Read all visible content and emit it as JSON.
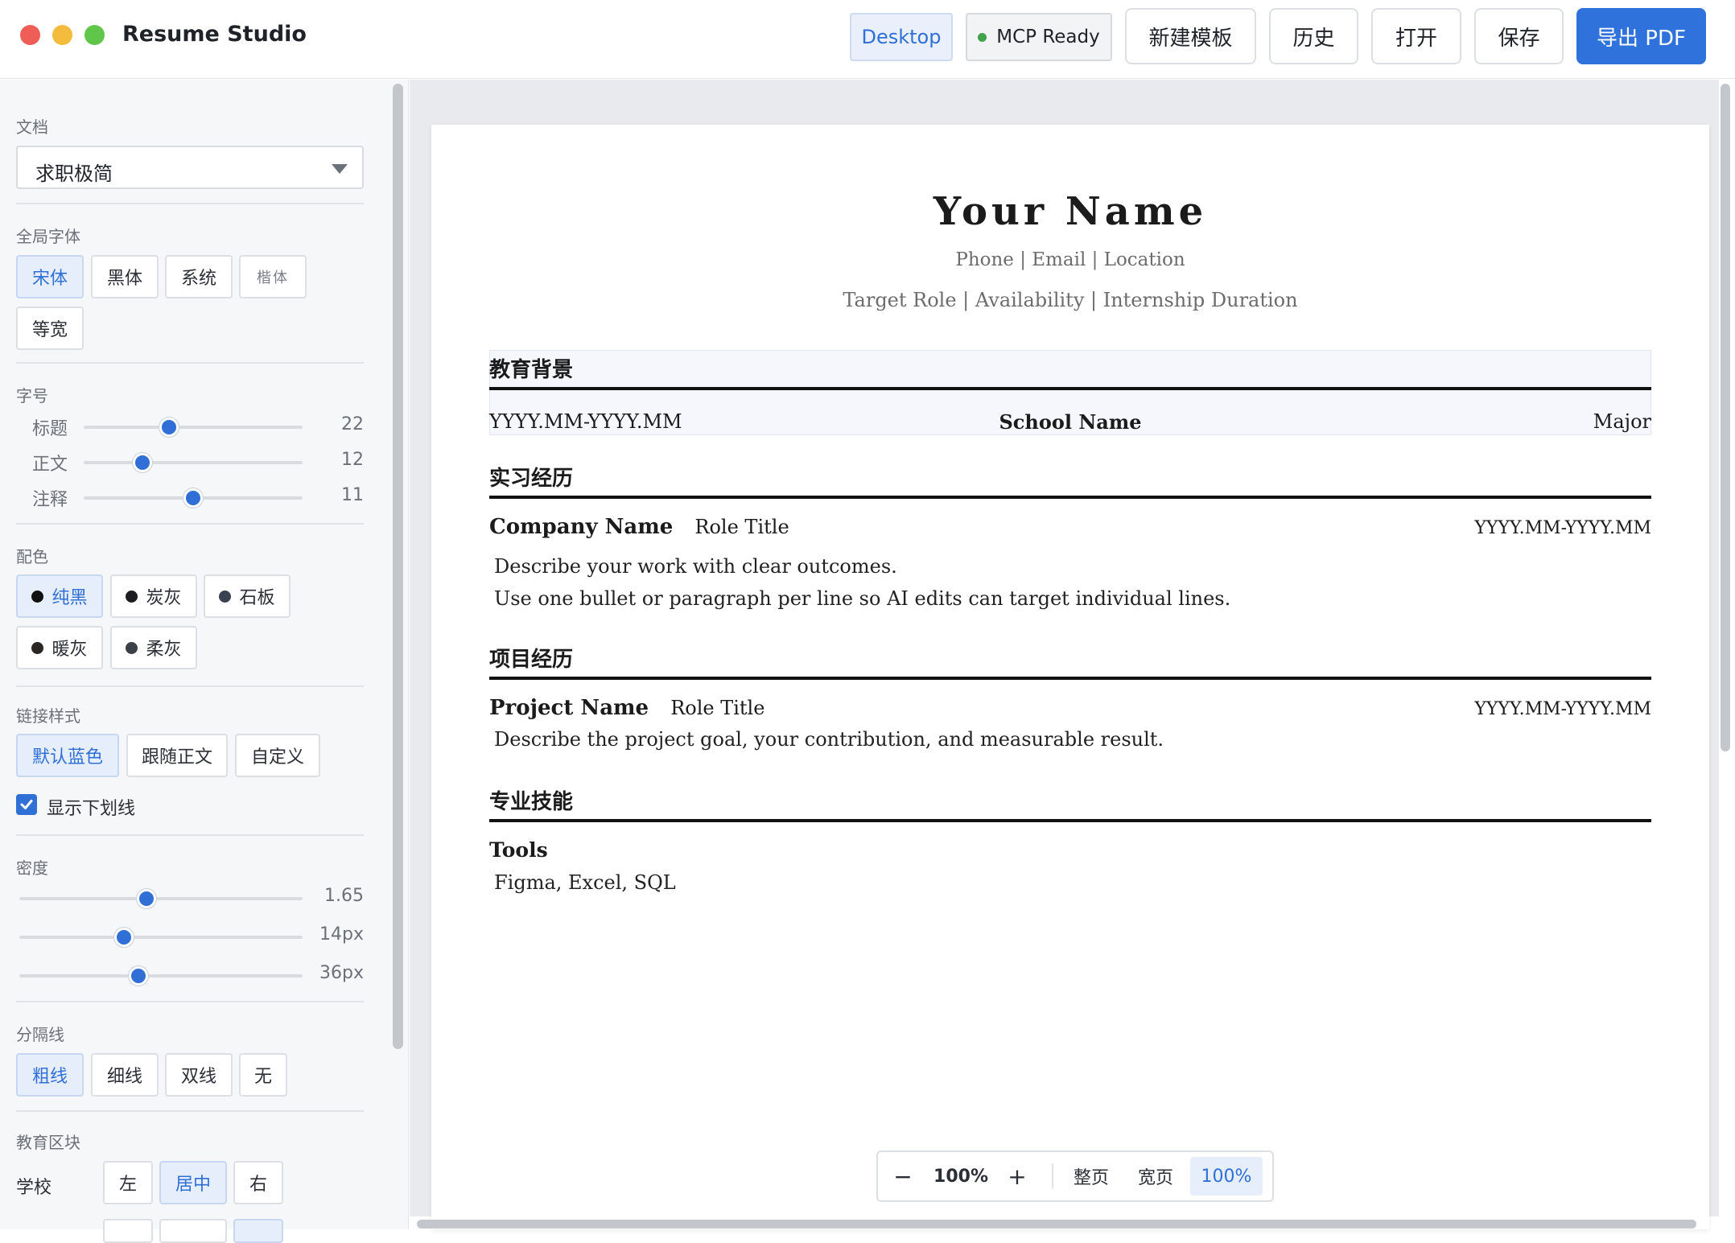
{
  "app": {
    "title": "Resume Studio"
  },
  "toolbar": {
    "desktop_label": "Desktop",
    "mcp_label": "MCP Ready",
    "new_template_label": "新建模板",
    "history_label": "历史",
    "open_label": "打开",
    "save_label": "保存",
    "export_label": "导出 PDF"
  },
  "sidebar": {
    "document_label": "文档",
    "document_value": "求职极简",
    "font_label": "全局字体",
    "fonts": [
      "宋体",
      "黑体",
      "系统",
      "楷体",
      "等宽"
    ],
    "font_active": "宋体",
    "size_label": "字号",
    "sizes": [
      {
        "label": "标题",
        "value": "22",
        "fraction": 0.39
      },
      {
        "label": "正文",
        "value": "12",
        "fraction": 0.27
      },
      {
        "label": "注释",
        "value": "11",
        "fraction": 0.5
      }
    ],
    "color_label": "配色",
    "colors": [
      {
        "label": "纯黑",
        "swatch": "#111111",
        "active": true
      },
      {
        "label": "炭灰",
        "swatch": "#1d1d1f",
        "active": false
      },
      {
        "label": "石板",
        "swatch": "#3a4250",
        "active": false
      },
      {
        "label": "暖灰",
        "swatch": "#2a2624",
        "active": false
      },
      {
        "label": "柔灰",
        "swatch": "#3a3f48",
        "active": false
      }
    ],
    "link_label": "链接样式",
    "link_styles": [
      "默认蓝色",
      "跟随正文",
      "自定义"
    ],
    "underline_label": "显示下划线",
    "density_label": "密度",
    "density": [
      {
        "value": "1.65",
        "fraction": 0.45
      },
      {
        "value": "14px",
        "fraction": 0.37
      },
      {
        "value": "36px",
        "fraction": 0.42
      }
    ],
    "divider_label": "分隔线",
    "divider_styles": [
      "粗线",
      "细线",
      "双线",
      "无"
    ],
    "edu_block_label": "教育区块",
    "school_label": "学校",
    "school_align": [
      "左",
      "居中",
      "右"
    ]
  },
  "resume": {
    "name": "Your Name",
    "contact": "Phone | Email | Location",
    "target": "Target Role | Availability | Internship Duration",
    "education": {
      "title": "教育背景",
      "dates": "YYYY.MM-YYYY.MM",
      "school": "School Name",
      "major": "Major"
    },
    "internship": {
      "title": "实习经历",
      "company": "Company Name",
      "role": "Role Title",
      "dates": "YYYY.MM-YYYY.MM",
      "lines": [
        "Describe your work with clear outcomes.",
        "Use one bullet or paragraph per line so AI edits can target individual lines."
      ]
    },
    "projects": {
      "title": "项目经历",
      "project": "Project Name",
      "role": "Role Title",
      "dates": "YYYY.MM-YYYY.MM",
      "line": "Describe the project goal, your contribution, and measurable result."
    },
    "skills": {
      "title": "专业技能",
      "heading": "Tools",
      "line": "Figma, Excel, SQL"
    }
  },
  "zoom": {
    "minus": "−",
    "level": "100%",
    "plus": "+",
    "fit_page": "整页",
    "fit_width": "宽页",
    "actual": "100%"
  },
  "colors": {
    "accent": "#2f72dc",
    "ready": "#3fa34d"
  }
}
